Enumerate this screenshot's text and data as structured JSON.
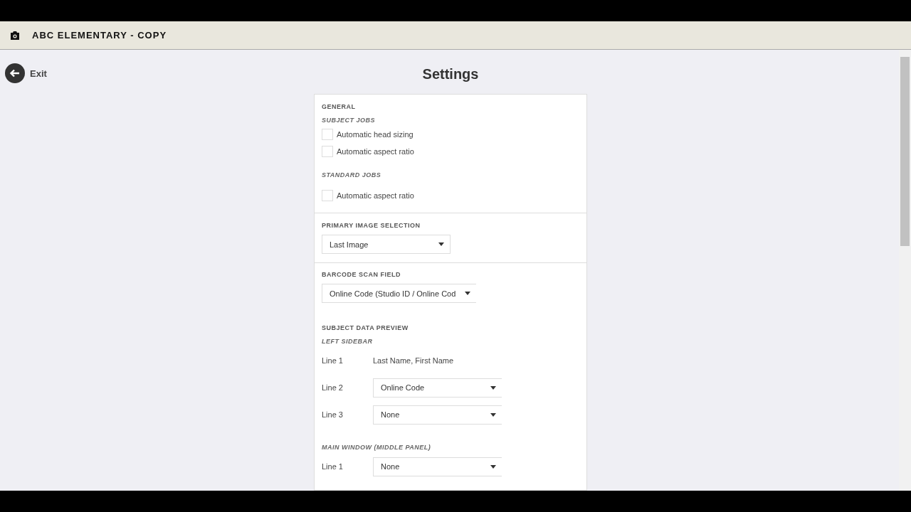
{
  "header": {
    "title": "ABC ELEMENTARY - COPY"
  },
  "exit": {
    "label": "Exit"
  },
  "page_title": "Settings",
  "general": {
    "heading": "GENERAL",
    "groups": [
      {
        "heading": "SUBJECT JOBS",
        "options": [
          {
            "label": "Automatic head sizing",
            "checked": false
          },
          {
            "label": "Automatic aspect ratio",
            "checked": false
          }
        ]
      },
      {
        "heading": "STANDARD JOBS",
        "options": [
          {
            "label": "Automatic aspect ratio",
            "checked": false
          }
        ]
      }
    ]
  },
  "primary_image_selection": {
    "heading": "PRIMARY IMAGE SELECTION",
    "value": "Last Image"
  },
  "barcode_scan_field": {
    "heading": "BARCODE SCAN FIELD",
    "value": "Online Code (Studio ID / Online Cod"
  },
  "subject_data_preview": {
    "heading": "SUBJECT DATA PREVIEW",
    "groups": [
      {
        "heading": "LEFT SIDEBAR",
        "lines": [
          {
            "label": "Line 1",
            "kind": "text",
            "value": "Last Name, First Name"
          },
          {
            "label": "Line 2",
            "kind": "select",
            "value": "Online Code"
          },
          {
            "label": "Line 3",
            "kind": "select",
            "value": "None"
          }
        ]
      },
      {
        "heading": "MAIN WINDOW (MIDDLE PANEL)",
        "lines": [
          {
            "label": "Line 1",
            "kind": "select",
            "value": "None"
          }
        ]
      }
    ]
  }
}
